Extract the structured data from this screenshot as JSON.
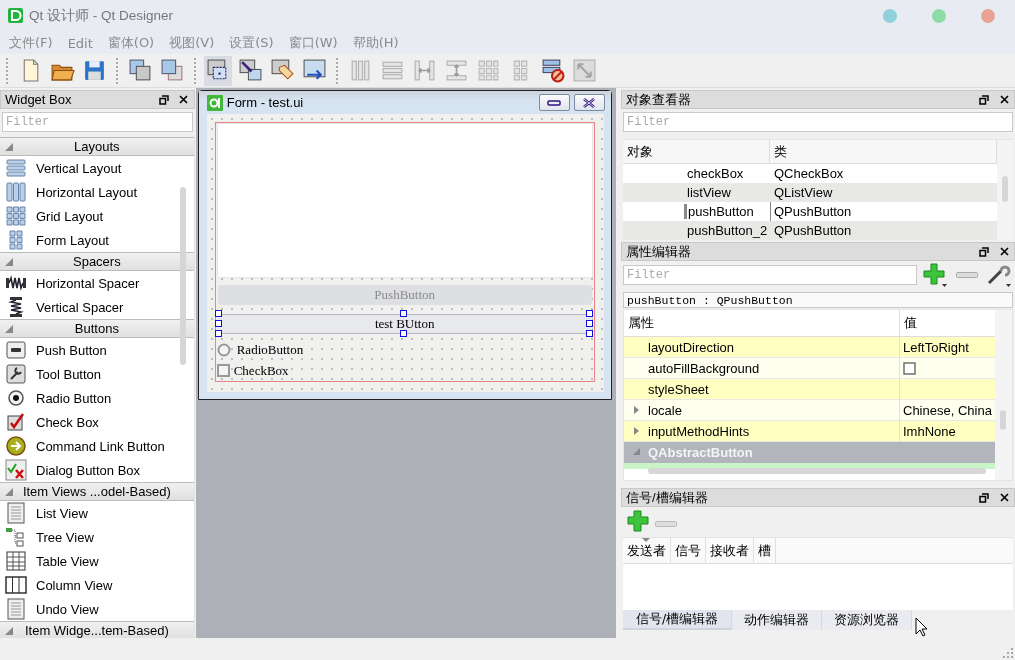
{
  "window": {
    "title": "Qt 设计师 - Qt Designer"
  },
  "menu": [
    {
      "label": "文件(F)"
    },
    {
      "label": "Edit"
    },
    {
      "label": "窗体(O)"
    },
    {
      "label": "视图(V)"
    },
    {
      "label": "设置(S)"
    },
    {
      "label": "窗口(W)"
    },
    {
      "label": "帮助(H)"
    }
  ],
  "toolbar": [
    [
      {
        "kind": "new",
        "selected": false,
        "disabled": false
      },
      {
        "kind": "open",
        "selected": false,
        "disabled": false
      },
      {
        "kind": "save",
        "selected": false,
        "disabled": false
      }
    ],
    [
      {
        "kind": "send-back",
        "selected": false,
        "disabled": false
      },
      {
        "kind": "bring-front",
        "selected": false,
        "disabled": false
      }
    ],
    [
      {
        "kind": "edit-widgets",
        "selected": true,
        "disabled": false
      },
      {
        "kind": "edit-signals",
        "selected": false,
        "disabled": false
      },
      {
        "kind": "edit-buddies",
        "selected": false,
        "disabled": false
      },
      {
        "kind": "edit-tab-order",
        "selected": false,
        "disabled": false
      }
    ],
    [
      {
        "kind": "layout-h",
        "selected": false,
        "disabled": true
      },
      {
        "kind": "layout-v",
        "selected": false,
        "disabled": true
      },
      {
        "kind": "splitter-h",
        "selected": false,
        "disabled": true
      },
      {
        "kind": "splitter-v",
        "selected": false,
        "disabled": true
      },
      {
        "kind": "layout-grid",
        "selected": false,
        "disabled": true
      },
      {
        "kind": "layout-form",
        "selected": false,
        "disabled": true
      },
      {
        "kind": "break-layout",
        "selected": false,
        "disabled": false
      },
      {
        "kind": "adjust-size",
        "selected": false,
        "disabled": true
      }
    ]
  ],
  "widget_box": {
    "title": "Widget Box",
    "filter_placeholder": "Filter",
    "categories": [
      {
        "label": "Layouts",
        "expanded": true,
        "items": [
          {
            "label": "Vertical Layout",
            "kind": "vlayout"
          },
          {
            "label": "Horizontal Layout",
            "kind": "hlayout"
          },
          {
            "label": "Grid Layout",
            "kind": "grid"
          },
          {
            "label": "Form Layout",
            "kind": "form"
          }
        ]
      },
      {
        "label": "Spacers",
        "expanded": true,
        "items": [
          {
            "label": "Horizontal Spacer",
            "kind": "hspacer"
          },
          {
            "label": "Vertical Spacer",
            "kind": "vspacer"
          }
        ]
      },
      {
        "label": "Buttons",
        "expanded": true,
        "items": [
          {
            "label": "Push Button",
            "kind": "pushbutton"
          },
          {
            "label": "Tool Button",
            "kind": "toolbutton"
          },
          {
            "label": "Radio Button",
            "kind": "radio"
          },
          {
            "label": "Check Box",
            "kind": "checkbox"
          },
          {
            "label": "Command Link Button",
            "kind": "commandlink"
          },
          {
            "label": "Dialog Button Box",
            "kind": "dialogbox"
          }
        ]
      },
      {
        "label": "Item Views ...odel-Based)",
        "expanded": true,
        "items": [
          {
            "label": "List View",
            "kind": "listview"
          },
          {
            "label": "Tree View",
            "kind": "treeview"
          },
          {
            "label": "Table View",
            "kind": "tableview"
          },
          {
            "label": "Column View",
            "kind": "columnview"
          },
          {
            "label": "Undo View",
            "kind": "undoview"
          }
        ]
      },
      {
        "label": "Item Widge...tem-Based)",
        "expanded": true
      }
    ]
  },
  "form": {
    "title": "Form - test.ui",
    "buttons": [
      {
        "label": "PushButton",
        "disabled": true,
        "selected": false
      },
      {
        "label": "test BUtton",
        "disabled": false,
        "selected": true
      }
    ],
    "radio": {
      "label": "RadioButton",
      "checked": false
    },
    "checkbox": {
      "label": "CheckBox",
      "checked": false
    }
  },
  "object_inspector": {
    "title": "对象查看器",
    "filter_placeholder": "Filter",
    "columns": [
      "对象",
      "类"
    ],
    "rows": [
      {
        "object": "checkBox",
        "class": "QCheckBox",
        "selected": false
      },
      {
        "object": "listView",
        "class": "QListView",
        "selected": false
      },
      {
        "object": "pushButton",
        "class": "QPushButton",
        "selected": true
      },
      {
        "object": "pushButton_2",
        "class": "QPushButton",
        "selected": false
      }
    ]
  },
  "property_editor": {
    "title": "属性编辑器",
    "filter_placeholder": "Filter",
    "object_label": "pushButton : QPushButton",
    "columns": [
      "属性",
      "值"
    ],
    "rows": [
      {
        "kind": "text",
        "name": "layoutDirection",
        "value": "LeftToRight"
      },
      {
        "kind": "checkbox",
        "name": "autoFillBackground",
        "checked": false
      },
      {
        "kind": "text",
        "name": "styleSheet"
      },
      {
        "kind": "expandable",
        "name": "locale",
        "value": "Chinese, China",
        "expanded": false
      },
      {
        "kind": "expandable",
        "name": "inputMethodHints",
        "value": "ImhNone",
        "expanded": false
      },
      {
        "kind": "group",
        "name": "QAbstractButton",
        "expanded": true
      }
    ]
  },
  "signal_slot_editor": {
    "title": "信号/槽编辑器",
    "columns": [
      "发送者",
      "信号",
      "接收者",
      "槽"
    ],
    "tabs": [
      {
        "label": "信号/槽编辑器",
        "selected": true
      },
      {
        "label": "动作编辑器",
        "selected": false
      },
      {
        "label": "资源浏览器",
        "selected": false
      }
    ]
  }
}
